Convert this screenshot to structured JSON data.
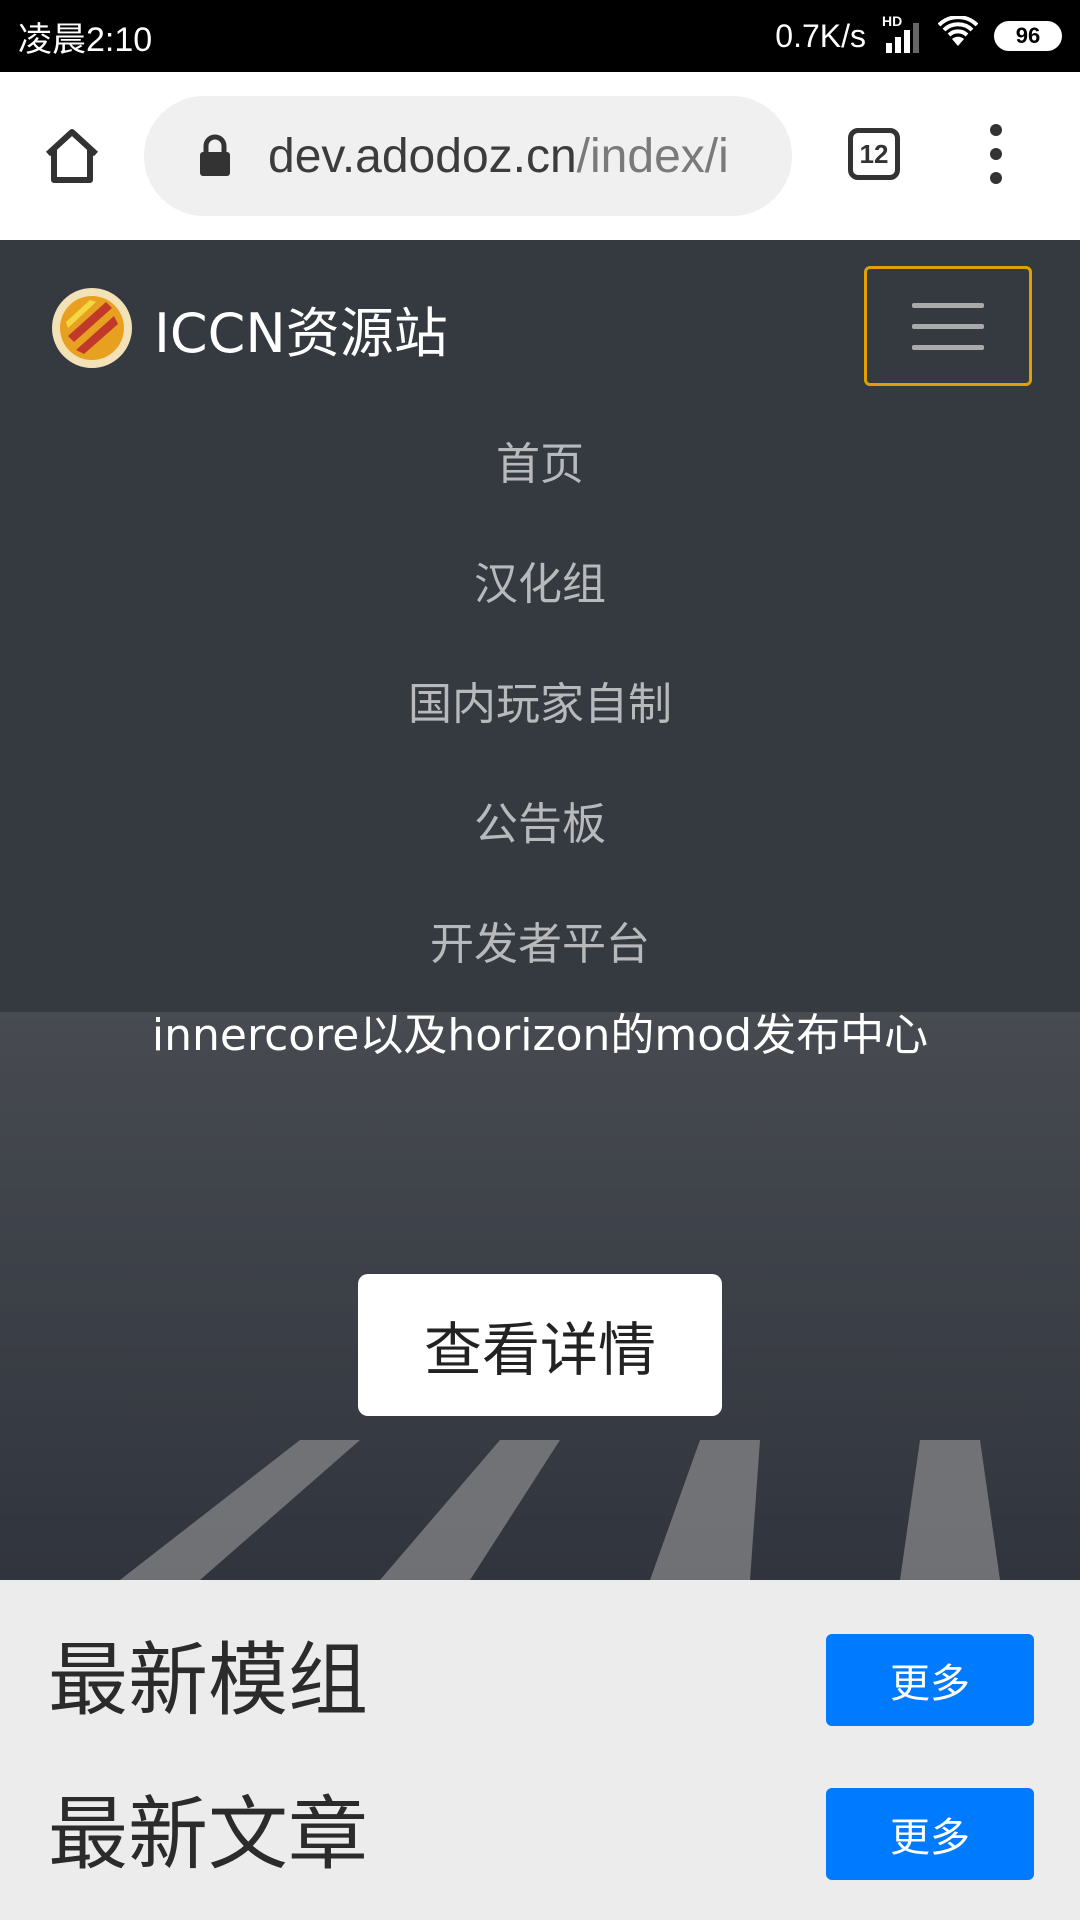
{
  "status_bar": {
    "time": "凌晨2:10",
    "net_speed": "0.7K/s",
    "signal_label": "HD",
    "battery": "96"
  },
  "browser": {
    "url_host": "dev.adodoz.cn",
    "url_path": "/index/i",
    "tab_count": "12"
  },
  "navbar": {
    "brand": "ICCN资源站",
    "items": [
      {
        "label": "首页"
      },
      {
        "label": "汉化组"
      },
      {
        "label": "国内玩家自制"
      },
      {
        "label": "公告板"
      },
      {
        "label": "开发者平台"
      }
    ]
  },
  "hero": {
    "description": "innercore以及horizon的mod发布中心",
    "button": "查看详情"
  },
  "sections": [
    {
      "title": "最新模组",
      "more": "更多"
    },
    {
      "title": "最新文章",
      "more": "更多"
    }
  ],
  "colors": {
    "navbar_bg": "#343a40",
    "primary": "#007bff",
    "toggler_border": "#e0a100"
  }
}
